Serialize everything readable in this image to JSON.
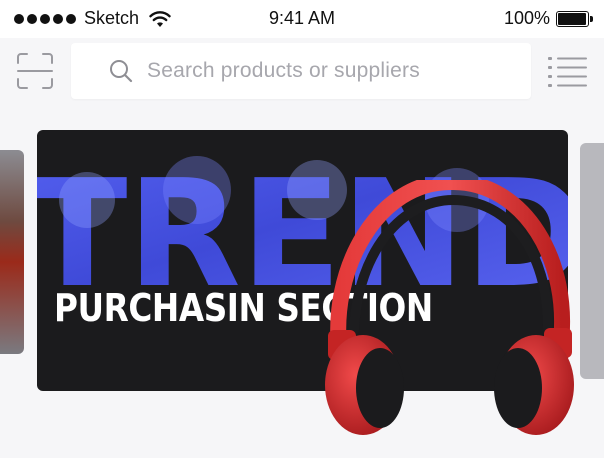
{
  "status_bar": {
    "carrier": "Sketch",
    "time": "9:41 AM",
    "battery": "100%",
    "signal_icon": "signal-dots-icon",
    "wifi_icon": "wifi-icon",
    "battery_icon": "battery-icon"
  },
  "header": {
    "search_placeholder": "Search products or suppliers",
    "scan_icon": "scan-icon",
    "menu_icon": "list-menu-icon"
  },
  "banner": {
    "headline": "TREND",
    "title": "PURCHASIN SECTION",
    "image": "headphones"
  },
  "colors": {
    "banner_bg": "#1b1b1d",
    "headline_blue": "#4a55e6",
    "headphones_red": "#d62a2a"
  }
}
